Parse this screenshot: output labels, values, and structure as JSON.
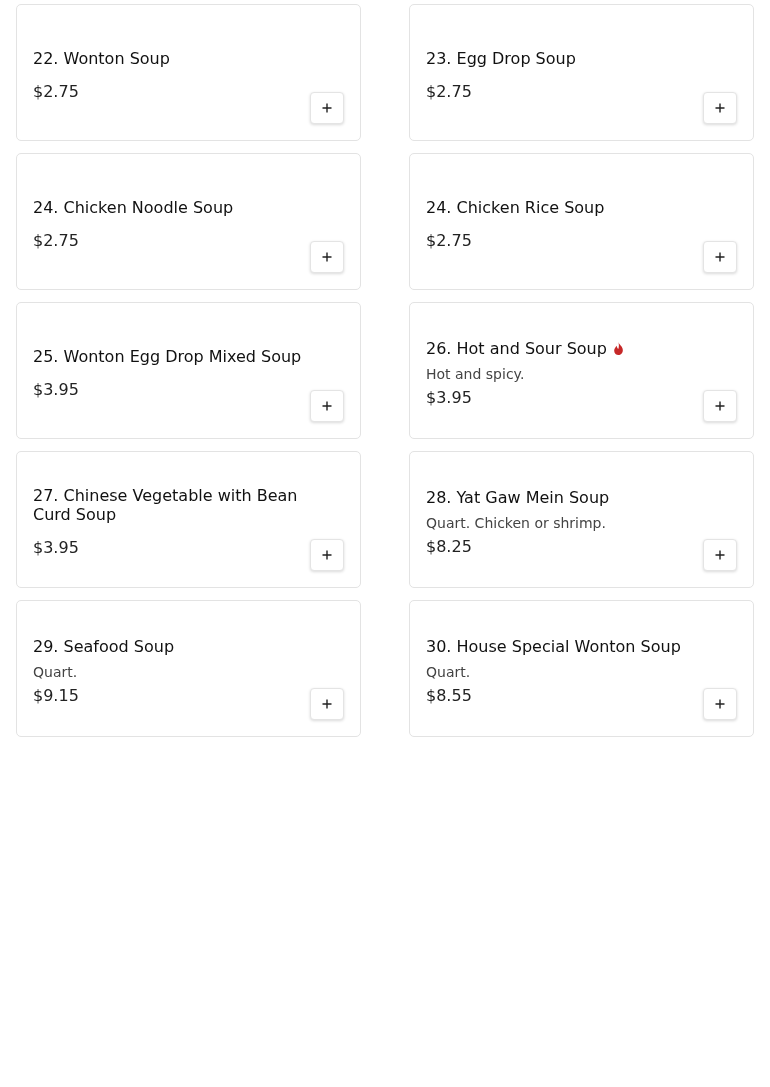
{
  "items": [
    {
      "name": "22. Wonton Soup",
      "price": "$2.75",
      "spicy": false
    },
    {
      "name": "23. Egg Drop Soup",
      "price": "$2.75",
      "spicy": false
    },
    {
      "name": "24. Chicken Noodle Soup",
      "price": "$2.75",
      "spicy": false
    },
    {
      "name": "24. Chicken Rice Soup",
      "price": "$2.75",
      "spicy": false
    },
    {
      "name": "25. Wonton Egg Drop Mixed Soup",
      "price": "$3.95",
      "spicy": false
    },
    {
      "name": "26. Hot and Sour Soup",
      "description": "Hot and spicy.",
      "price": "$3.95",
      "spicy": true
    },
    {
      "name": "27. Chinese Vegetable with Bean Curd Soup",
      "price": "$3.95",
      "spicy": false
    },
    {
      "name": "28. Yat Gaw Mein Soup",
      "description": "Quart. Chicken or shrimp.",
      "price": "$8.25",
      "spicy": false
    },
    {
      "name": "29. Seafood Soup",
      "description": "Quart.",
      "price": "$9.15",
      "spicy": false
    },
    {
      "name": "30. House Special Wonton Soup",
      "description": "Quart.",
      "price": "$8.55",
      "spicy": false
    }
  ]
}
